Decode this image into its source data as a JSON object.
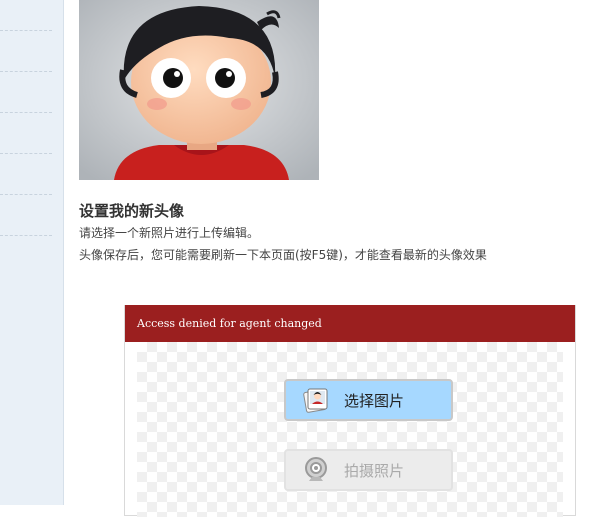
{
  "avatar": {
    "alt_icon": "cartoon-avatar"
  },
  "profile": {
    "title": "设置我的新头像",
    "line1": "请选择一个新照片进行上传编辑。",
    "line2": "头像保存后，您可能需要刷新一下本页面(按F5键)，才能查看最新的头像效果"
  },
  "uploader": {
    "header": "Access denied for agent changed",
    "select_label": "选择图片",
    "capture_label": "拍摄照片",
    "icons": {
      "select": "photo-icon",
      "capture": "webcam-icon"
    }
  },
  "colors": {
    "header_bg": "#9b1f1f",
    "select_button_bg": "#a6d8ff",
    "sidebar_bg": "#e9f0f7"
  }
}
